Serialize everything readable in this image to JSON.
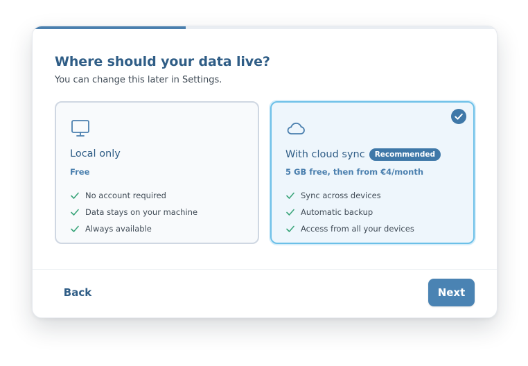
{
  "wizard": {
    "progress_fraction": 0.33,
    "title": "Where should your data live?",
    "subtitle": "You can change this later in Settings."
  },
  "options": [
    {
      "id": "local",
      "icon": "monitor-icon",
      "title": "Local only",
      "price": "Free",
      "selected": false,
      "features": [
        "No account required",
        "Data stays on your machine",
        "Always available"
      ]
    },
    {
      "id": "cloud",
      "icon": "cloud-icon",
      "title": "With cloud sync",
      "badge": "Recommended",
      "price": "5 GB free, then from €4/month",
      "selected": true,
      "features": [
        "Sync across devices",
        "Automatic backup",
        "Access from all your devices"
      ]
    }
  ],
  "footer": {
    "back_label": "Back",
    "next_label": "Next"
  },
  "colors": {
    "accent": "#4a7fae",
    "title": "#2f5d86",
    "check_green": "#3aa57a",
    "selected_border": "#6cc0e8"
  }
}
